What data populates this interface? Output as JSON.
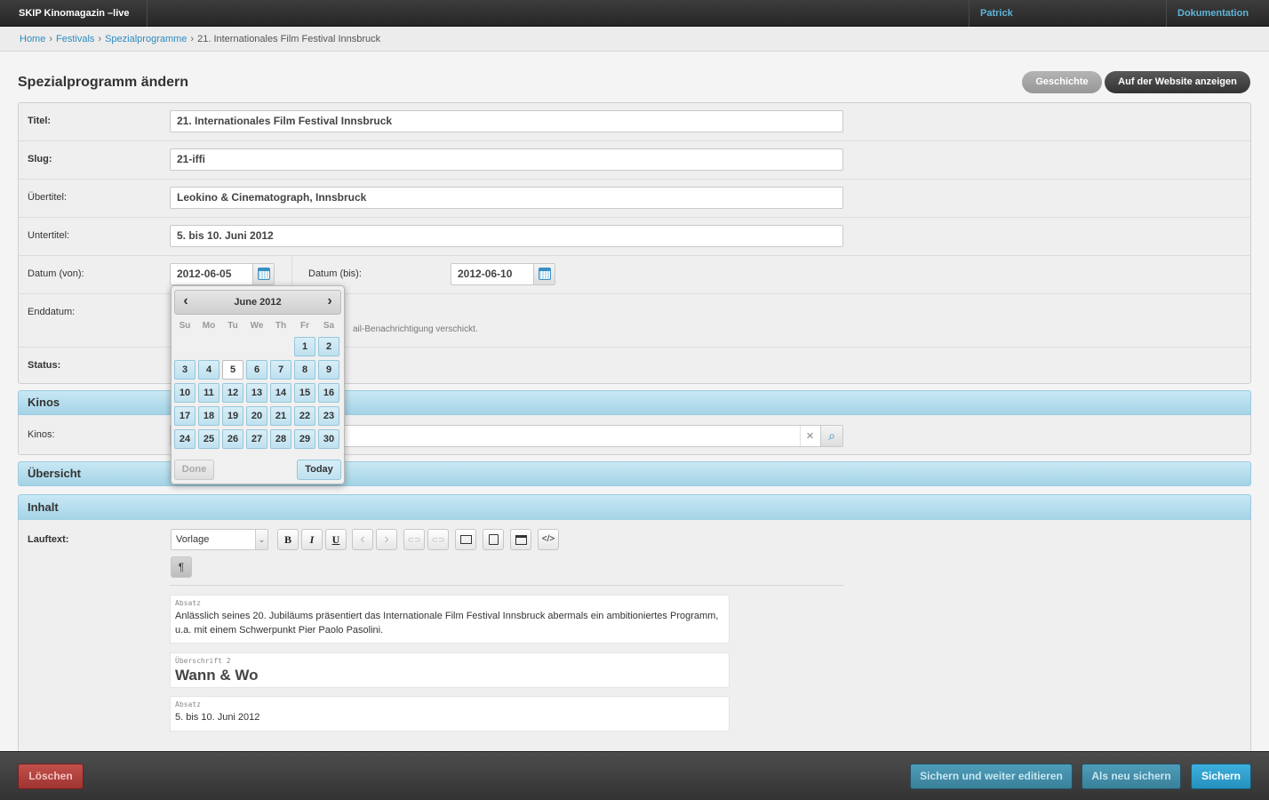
{
  "header": {
    "app_title": "SKIP Kinomagazin –live",
    "user": "Patrick",
    "docs": "Dokumentation"
  },
  "breadcrumb": {
    "items": [
      "Home",
      "Festivals",
      "Spezialprogramme"
    ],
    "current": "21. Internationales Film Festival Innsbruck",
    "separator": "›"
  },
  "page": {
    "title": "Spezialprogramm ändern",
    "history_label": "Geschichte",
    "view_site_label": "Auf der Website anzeigen"
  },
  "form": {
    "titel": {
      "label": "Titel:",
      "value": "21. Internationales Film Festival Innsbruck"
    },
    "slug": {
      "label": "Slug:",
      "value": "21-iffi"
    },
    "uebertitel": {
      "label": "Übertitel:",
      "value": "Leokino & Cinematograph, Innsbruck"
    },
    "untertitel": {
      "label": "Untertitel:",
      "value": "5. bis 10. Juni 2012"
    },
    "datum_von": {
      "label": "Datum (von):",
      "value": "2012-06-05"
    },
    "datum_bis": {
      "label": "Datum (bis):",
      "value": "2012-06-10"
    },
    "enddatum": {
      "label": "Enddatum:",
      "help_fragment": "ail-Benachrichtigung verschickt."
    },
    "status": {
      "label": "Status:"
    }
  },
  "kinos": {
    "section_title": "Kinos",
    "label": "Kinos:",
    "clear_icon": "close-icon",
    "search_icon": "search-icon"
  },
  "uebersicht": {
    "section_title": "Übersicht"
  },
  "inhalt": {
    "section_title": "Inhalt",
    "label": "Lauftext:",
    "format_select": "Vorlage",
    "toolbar": {
      "bold": "B",
      "italic": "I",
      "underline": "U",
      "undo": "‹",
      "redo": "›",
      "link": "⊂⊃",
      "unlink": "⊂⊃",
      "para": "¶",
      "source": "</>"
    },
    "blocks": [
      {
        "tag": "Absatz",
        "text": "Anlässlich seines 20. Jubiläums präsentiert das Internationale Film Festival Innsbruck abermals ein ambitioniertes Programm, u.a. mit einem Schwerpunkt Pier Paolo Pasolini."
      },
      {
        "tag": "Überschrift 2",
        "text": "Wann & Wo"
      },
      {
        "tag": "Absatz",
        "text": "5. bis 10. Juni 2012"
      }
    ]
  },
  "footer": {
    "delete": "Löschen",
    "save_continue": "Sichern und weiter editieren",
    "save_new": "Als neu sichern",
    "save": "Sichern"
  },
  "datepicker": {
    "month_label": "June 2012",
    "prev": "‹",
    "next": "›",
    "weekdays": [
      "Su",
      "Mo",
      "Tu",
      "We",
      "Th",
      "Fr",
      "Sa"
    ],
    "days": [
      1,
      2,
      3,
      4,
      5,
      6,
      7,
      8,
      9,
      10,
      11,
      12,
      13,
      14,
      15,
      16,
      17,
      18,
      19,
      20,
      21,
      22,
      23,
      24,
      25,
      26,
      27,
      28,
      29,
      30
    ],
    "first_weekday_index": 5,
    "selected_day": 5,
    "done_label": "Done",
    "today_label": "Today"
  }
}
